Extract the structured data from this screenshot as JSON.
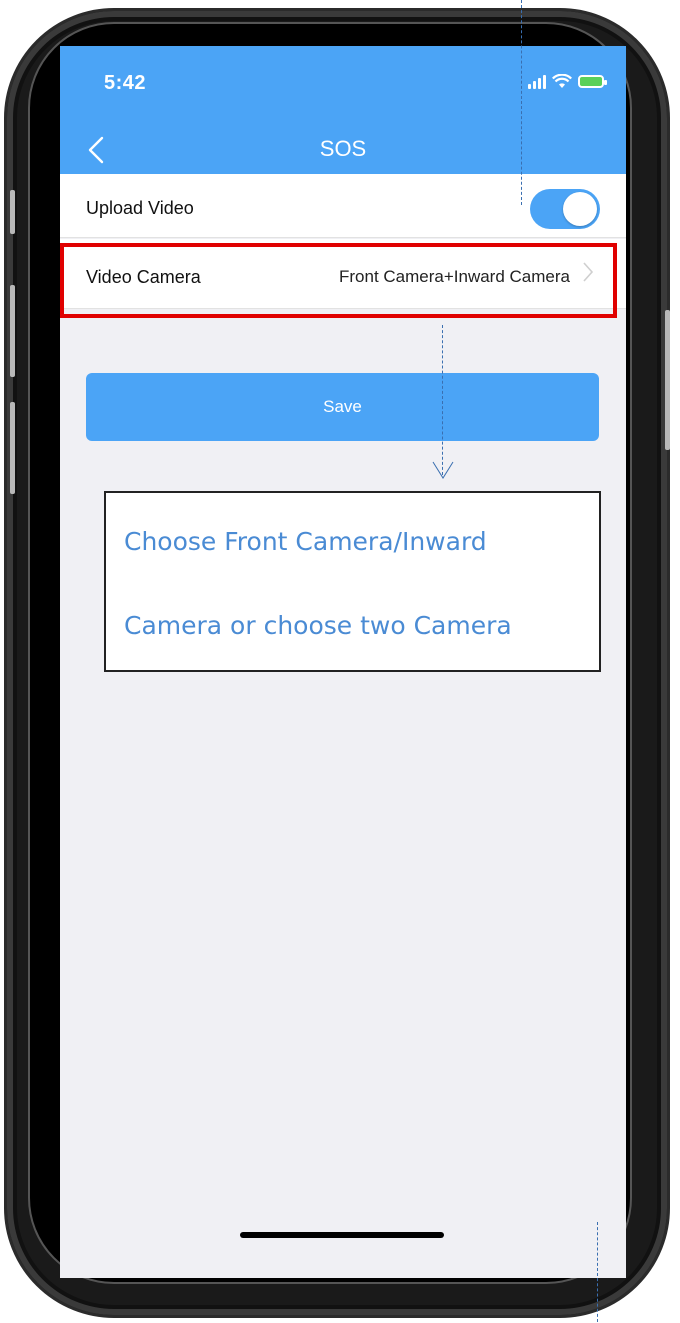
{
  "status_bar": {
    "time": "5:42"
  },
  "nav": {
    "title": "SOS",
    "back_icon": "chevron-left-icon"
  },
  "settings": {
    "upload_video": {
      "label": "Upload Video",
      "toggle_on": true
    },
    "video_camera": {
      "label": "Video Camera",
      "value": "Front Camera+Inward Camera"
    }
  },
  "actions": {
    "save_label": "Save"
  },
  "annotation": {
    "line1": "Choose Front Camera/Inward",
    "line2": "Camera or choose two Camera"
  },
  "colors": {
    "accent": "#4ba4f6",
    "highlight": "#e00000",
    "callout_text": "#4a8bd4"
  }
}
